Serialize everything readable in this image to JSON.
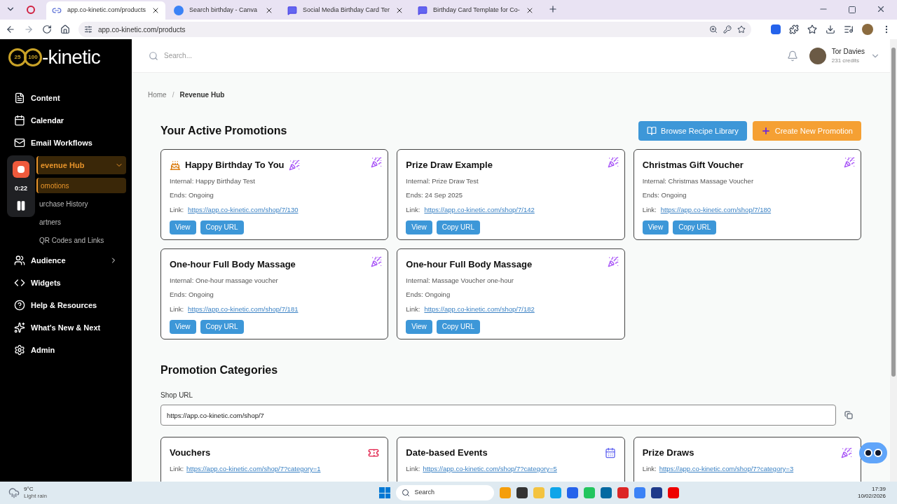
{
  "browser": {
    "tabs": [
      {
        "title": "app.co-kinetic.com/products",
        "selected": true,
        "kind": "link"
      },
      {
        "title": "Search birthday - Canva",
        "selected": false,
        "kind": "canva"
      },
      {
        "title": "Social Media Birthday Card Ter",
        "selected": false,
        "kind": "chat"
      },
      {
        "title": "Birthday Card Template for Co-",
        "selected": false,
        "kind": "chat"
      }
    ],
    "url": "app.co-kinetic.com/products"
  },
  "sidebar": {
    "logo": {
      "badges": [
        "25",
        "100"
      ],
      "text": "-kinetic"
    },
    "items": [
      {
        "label": "Content",
        "kind": "file",
        "selected": false
      },
      {
        "label": "Calendar",
        "kind": "calendar",
        "selected": false
      },
      {
        "label": "Email Workflows",
        "kind": "mail",
        "selected": false
      },
      {
        "label": "evenue Hub",
        "selected": true,
        "expanded": true,
        "children": [
          {
            "label": "omotions",
            "selected": true
          },
          {
            "label": "urchase History",
            "selected": false
          },
          {
            "label": "artners",
            "selected": false
          },
          {
            "label": "QR Codes and Links",
            "selected": false
          }
        ]
      },
      {
        "label": "Audience",
        "kind": "users",
        "selected": false,
        "expanded": false
      },
      {
        "label": "Widgets",
        "kind": "code",
        "selected": false
      },
      {
        "label": "Help & Resources",
        "kind": "help",
        "selected": false
      },
      {
        "label": "What's New & Next",
        "kind": "sparkles",
        "selected": false
      },
      {
        "label": "Admin",
        "kind": "settings",
        "selected": false
      }
    ]
  },
  "recorder": {
    "time": "0:22"
  },
  "topbar": {
    "search_placeholder": "Search...",
    "user": {
      "name": "Tor Davies",
      "credits": "231 credits"
    }
  },
  "breadcrumb": {
    "separator": "/",
    "items": [
      "Home",
      "Revenue Hub"
    ]
  },
  "promotions": {
    "heading": "Your Active Promotions",
    "buttons": [
      {
        "label": "Browse Recipe Library",
        "kind": "library"
      },
      {
        "label": "Create New Promotion",
        "kind": "create"
      }
    ],
    "cards": [
      {
        "title": "Happy Birthday To You",
        "kind": "birthday",
        "internal": "Internal: Happy Birthday Test",
        "ends": "Ends: Ongoing",
        "link_label": "Link:",
        "link": "https://app.co-kinetic.com/shop/7/130",
        "actions": [
          "View",
          "Copy URL"
        ]
      },
      {
        "title": "Prize Draw Example",
        "kind": "plain",
        "internal": "Internal: Prize Draw Test",
        "ends": "Ends: 24 Sep 2025",
        "link_label": "Link:",
        "link": "https://app.co-kinetic.com/shop/7/142",
        "actions": [
          "View",
          "Copy URL"
        ]
      },
      {
        "title": "Christmas Gift Voucher",
        "kind": "plain",
        "internal": "Internal: Christmas Massage Voucher",
        "ends": "Ends: Ongoing",
        "link_label": "Link:",
        "link": "https://app.co-kinetic.com/shop/7/180",
        "actions": [
          "View",
          "Copy URL"
        ]
      },
      {
        "title": "One-hour Full Body Massage",
        "kind": "plain",
        "internal": "Internal: One-hour massage voucher",
        "ends": "Ends: Ongoing",
        "link_label": "Link:",
        "link": "https://app.co-kinetic.com/shop/7/181",
        "actions": [
          "View",
          "Copy URL"
        ]
      },
      {
        "title": "One-hour Full Body Massage",
        "kind": "plain",
        "internal": "Internal: Massage Voucher one-hour",
        "ends": "Ends: Ongoing",
        "link_label": "Link:",
        "link": "https://app.co-kinetic.com/shop/7/182",
        "actions": [
          "View",
          "Copy URL"
        ]
      }
    ]
  },
  "categories": {
    "heading": "Promotion Categories",
    "shop_url_label": "Shop URL",
    "shop_url": "https://app.co-kinetic.com/shop/7",
    "cards": [
      {
        "title": "Vouchers",
        "kind": "voucher",
        "link_label": "Link:",
        "link": "https://app.co-kinetic.com/shop/7?category=1"
      },
      {
        "title": "Date-based Events",
        "kind": "event",
        "link_label": "Link:",
        "link": "https://app.co-kinetic.com/shop/7?category=5"
      },
      {
        "title": "Prize Draws",
        "kind": "draw",
        "link_label": "Link:",
        "link": "https://app.co-kinetic.com/shop/7?category=3"
      }
    ]
  },
  "taskbar": {
    "temperature": "9°C",
    "weather": "Light rain",
    "search_placeholder": "Search",
    "time": "17:39",
    "date": "10/02/2026"
  }
}
